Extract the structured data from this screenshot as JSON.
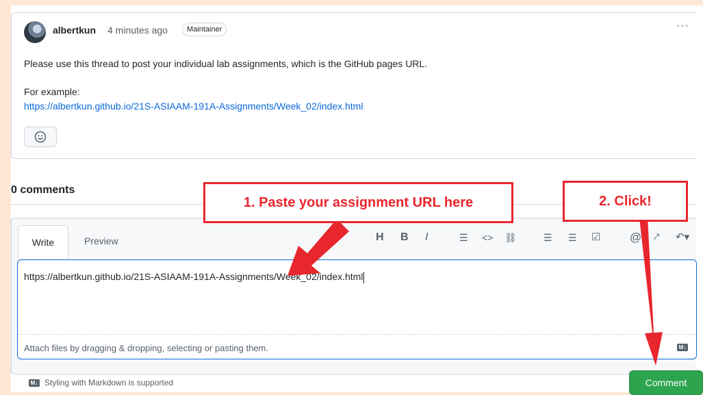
{
  "post": {
    "author": "albertkun",
    "time": "4 minutes ago",
    "badge": "Maintainer",
    "more": "···",
    "body": "Please use this thread to post your individual lab assignments, which is the GitHub pages URL.",
    "example_label": "For example:",
    "example_link": "https://albertkun.github.io/21S-ASIAAM-191A-Assignments/Week_02/index.html",
    "reaction_icon": "smiley-icon"
  },
  "comments": {
    "count_label": "0 comments"
  },
  "editor": {
    "tabs": {
      "write": "Write",
      "preview": "Preview"
    },
    "toolbar": [
      "heading",
      "bold",
      "italic",
      "quote",
      "code",
      "link",
      "unordered-list",
      "ordered-list",
      "task-list",
      "mention",
      "reference",
      "reply"
    ],
    "toolbar_glyphs": {
      "heading": "H",
      "bold": "B",
      "italic": "I",
      "quote": "☰",
      "code": "<>",
      "link": "⛓",
      "ul": "☰",
      "ol": "☰",
      "task": "☑",
      "mention": "@",
      "reference": "⤤",
      "reply": "↶▾"
    },
    "value": "https://albertkun.github.io/21S-ASIAAM-191A-Assignments/Week_02/index.html",
    "attach_text": "Attach files by dragging & dropping, selecting or pasting them.",
    "md_chip": "M↓"
  },
  "footer": {
    "markdown_note": "Styling with Markdown is supported",
    "md_chip": "M↓",
    "comment_button": "Comment"
  },
  "annotations": {
    "step1": "1. Paste your assignment URL here",
    "step2": "2. Click!",
    "color": "#e8262d"
  }
}
